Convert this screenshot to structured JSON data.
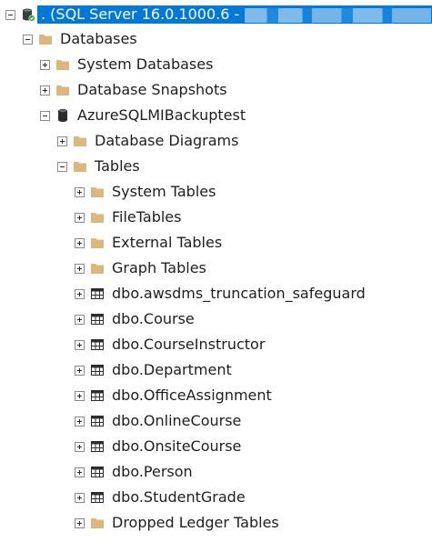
{
  "server": {
    "label": ". (SQL Server 16.0.1000.6 -",
    "masked_name": "[blurred]"
  },
  "databases": {
    "label": "Databases",
    "system_databases": "System Databases",
    "database_snapshots": "Database Snapshots",
    "db": {
      "label": "AzureSQLMIBackuptest",
      "database_diagrams": "Database Diagrams",
      "tables": {
        "label": "Tables",
        "folders": [
          "System Tables",
          "FileTables",
          "External Tables",
          "Graph Tables"
        ],
        "items": [
          "dbo.awsdms_truncation_safeguard",
          "dbo.Course",
          "dbo.CourseInstructor",
          "dbo.Department",
          "dbo.OfficeAssignment",
          "dbo.OnlineCourse",
          "dbo.OnsiteCourse",
          "dbo.Person",
          "dbo.StudentGrade"
        ],
        "dropped": "Dropped Ledger Tables"
      }
    }
  },
  "colors": {
    "selection": "#0078d7",
    "folder": "#dcb67a",
    "text": "#1e1e1e"
  }
}
